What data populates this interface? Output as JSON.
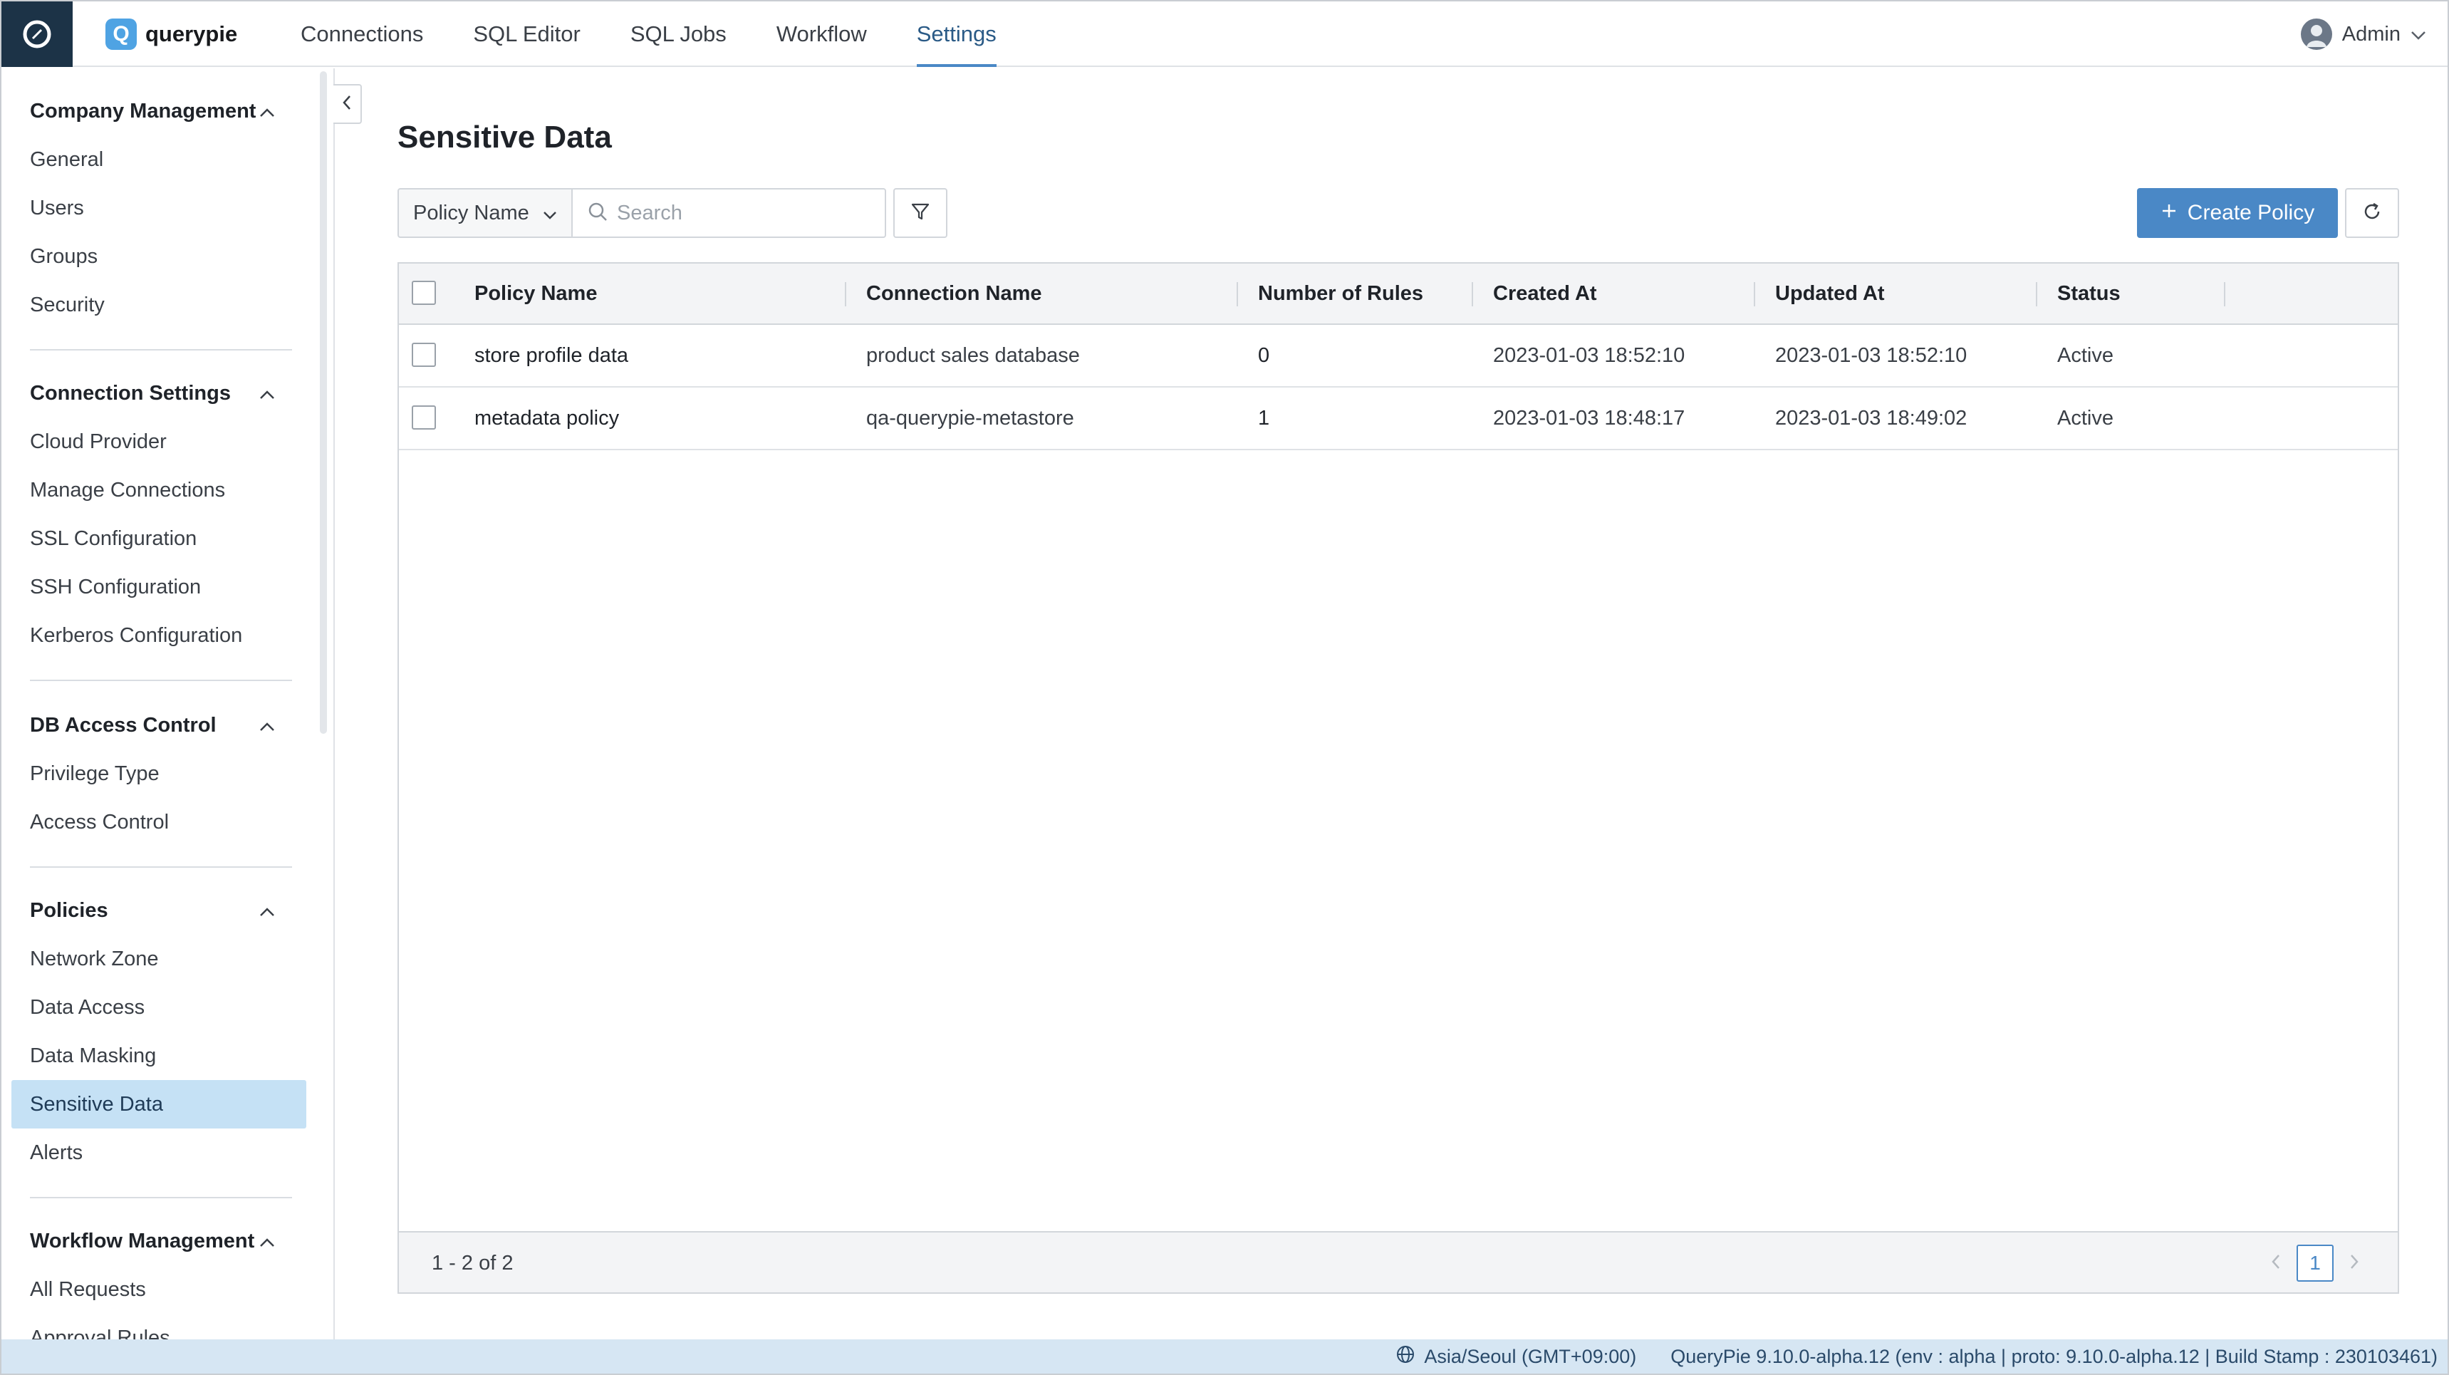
{
  "topbar": {
    "brand": "querypie",
    "brand_mark": "Q",
    "nav": [
      "Connections",
      "SQL Editor",
      "SQL Jobs",
      "Workflow",
      "Settings"
    ],
    "active_nav": "Settings",
    "user": "Admin"
  },
  "sidebar": {
    "groups": [
      {
        "title": "Company Management",
        "items": [
          "General",
          "Users",
          "Groups",
          "Security"
        ]
      },
      {
        "title": "Connection Settings",
        "items": [
          "Cloud Provider",
          "Manage Connections",
          "SSL Configuration",
          "SSH Configuration",
          "Kerberos Configuration"
        ]
      },
      {
        "title": "DB Access Control",
        "items": [
          "Privilege Type",
          "Access Control"
        ]
      },
      {
        "title": "Policies",
        "items": [
          "Network Zone",
          "Data Access",
          "Data Masking",
          "Sensitive Data",
          "Alerts"
        ]
      },
      {
        "title": "Workflow Management",
        "items": [
          "All Requests",
          "Approval Rules"
        ]
      }
    ],
    "active_item": "Sensitive Data"
  },
  "main": {
    "title": "Sensitive Data",
    "filter_field": "Policy Name",
    "search_placeholder": "Search",
    "create_button": "Create Policy",
    "table": {
      "columns": [
        "Policy Name",
        "Connection Name",
        "Number of Rules",
        "Created At",
        "Updated At",
        "Status"
      ],
      "rows": [
        [
          "store profile data",
          "product sales database",
          "0",
          "2023-01-03 18:52:10",
          "2023-01-03 18:52:10",
          "Active"
        ],
        [
          "metadata policy",
          "qa-querypie-metastore",
          "1",
          "2023-01-03 18:48:17",
          "2023-01-03 18:49:02",
          "Active"
        ]
      ]
    },
    "pagination": {
      "range": "1 - 2 of 2",
      "current_page": "1"
    }
  },
  "statusbar": {
    "timezone": "Asia/Seoul (GMT+09:00)",
    "version": "QueryPie 9.10.0-alpha.12 (env : alpha | proto: 9.10.0-alpha.12 | Build Stamp : 230103461)"
  },
  "colors": {
    "accent": "#4a88c6",
    "active_bg": "#c5e1f5",
    "corner": "#1c3347",
    "statusbar": "#d6e6f3"
  },
  "icons": [
    "app-logo-icon",
    "chevron-up-icon",
    "chevron-down-icon",
    "chevron-left-icon",
    "search-icon",
    "filter-icon",
    "plus-icon",
    "refresh-icon",
    "globe-icon",
    "chevron-right-icon"
  ]
}
